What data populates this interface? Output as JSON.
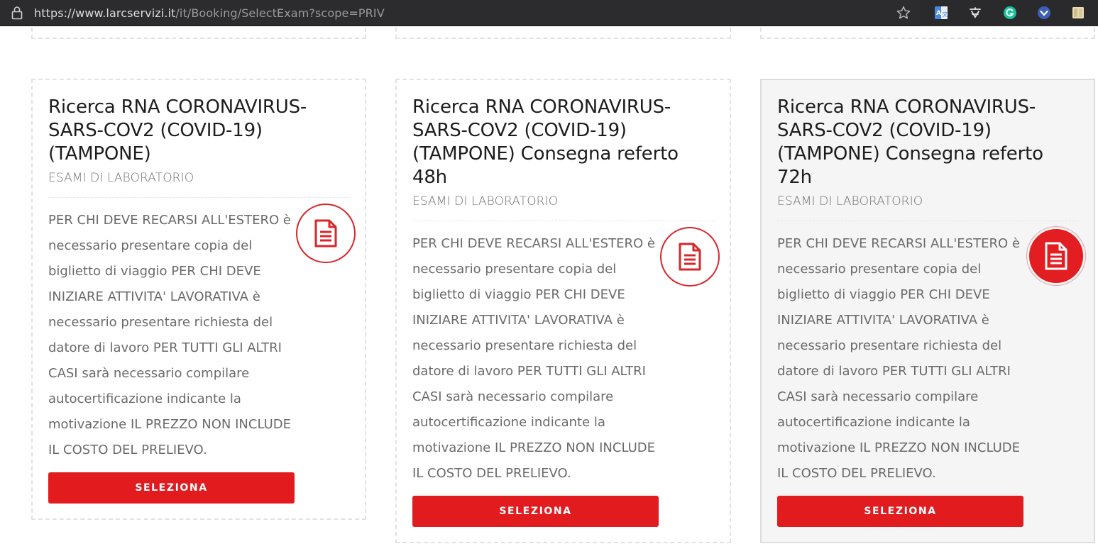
{
  "browser": {
    "url_host": "https://www.larcservizi.it",
    "url_path": "/it/Booking/SelectExam?scope=PRIV",
    "icons": [
      "lock-icon",
      "bookmark-star-icon",
      "translate-extension-icon",
      "dictionary-extension-icon",
      "grammarly-extension-icon",
      "vpn-extension-icon",
      "reader-extension-icon"
    ]
  },
  "exams": [
    {
      "title": "Ricerca RNA CORONAVIRUS-SARS-COV2 (COVID-19) (TAMPONE)",
      "category": "ESAMI DI LABORATORIO",
      "description": "PER CHI DEVE RECARSI ALL'ESTERO è necessario presentare copia del biglietto di viaggio PER CHI DEVE INIZIARE ATTIVITA' LAVORATIVA è necessario presentare richiesta del datore di lavoro PER TUTTI GLI ALTRI CASI sarà necessario compilare autocertificazione indicante la motivazione IL PREZZO NON INCLUDE IL COSTO DEL PRELIEVO.",
      "button_label": "SELEZIONA",
      "icon": "document-icon"
    },
    {
      "title": "Ricerca RNA CORONAVIRUS-SARS-COV2 (COVID-19) (TAMPONE) Consegna referto 48h",
      "category": "ESAMI DI LABORATORIO",
      "description": "PER CHI DEVE RECARSI ALL'ESTERO è necessario presentare copia del biglietto di viaggio PER CHI DEVE INIZIARE ATTIVITA' LAVORATIVA è necessario presentare richiesta del datore di lavoro PER TUTTI GLI ALTRI CASI sarà necessario compilare autocertificazione indicante la motivazione IL PREZZO NON INCLUDE IL COSTO DEL PRELIEVO.",
      "button_label": "SELEZIONA",
      "icon": "document-icon"
    },
    {
      "title": "Ricerca RNA CORONAVIRUS-SARS-COV2 (COVID-19) (TAMPONE) Consegna referto 72h",
      "category": "ESAMI DI LABORATORIO",
      "description": "PER CHI DEVE RECARSI ALL'ESTERO è necessario presentare copia del biglietto di viaggio PER CHI DEVE INIZIARE ATTIVITA' LAVORATIVA è necessario presentare richiesta del datore di lavoro PER TUTTI GLI ALTRI CASI sarà necessario compilare autocertificazione indicante la motivazione IL PREZZO NON INCLUDE IL COSTO DEL PRELIEVO.",
      "button_label": "SELEZIONA",
      "icon": "document-icon"
    }
  ],
  "colors": {
    "accent": "#e21b1f",
    "chrome_bg": "#2c2c2e",
    "hover_card_bg": "#f5f5f5"
  }
}
